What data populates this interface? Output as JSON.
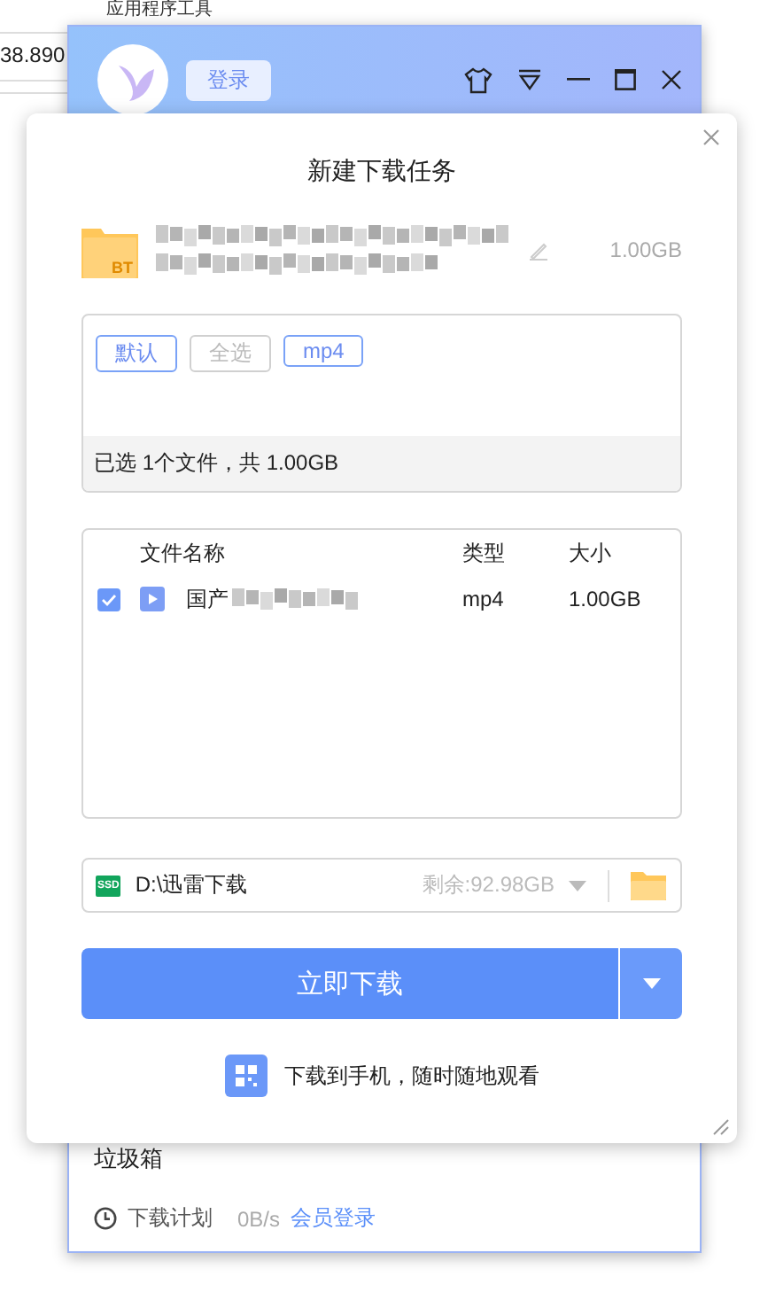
{
  "background_app": {
    "ribbon_tab": "应用程序工具",
    "cell_value": "38.890"
  },
  "main_window": {
    "login_button": "登录",
    "sidebar_item": "垃圾箱",
    "status": {
      "schedule": "下载计划",
      "speed": "0B/s",
      "member_link": "会员登录"
    }
  },
  "dialog": {
    "title": "新建下载任务",
    "file": {
      "badge": "BT",
      "size": "1.00GB"
    },
    "filters": [
      {
        "label": "默认",
        "selected": true
      },
      {
        "label": "全选",
        "selected": false
      },
      {
        "label": "mp4",
        "selected": true
      }
    ],
    "selection_summary": "已选 1个文件，共 1.00GB",
    "columns": [
      "文件名称",
      "类型",
      "大小"
    ],
    "rows": [
      {
        "checked": true,
        "name": "国产",
        "type": "mp4",
        "size": "1.00GB"
      }
    ],
    "drive_badge": "SSD",
    "save_path": "D:\\迅雷下载",
    "free_space": "剩余:92.98GB",
    "download_button": "立即下载",
    "mobile_hint": "下载到手机，随时随地观看"
  }
}
